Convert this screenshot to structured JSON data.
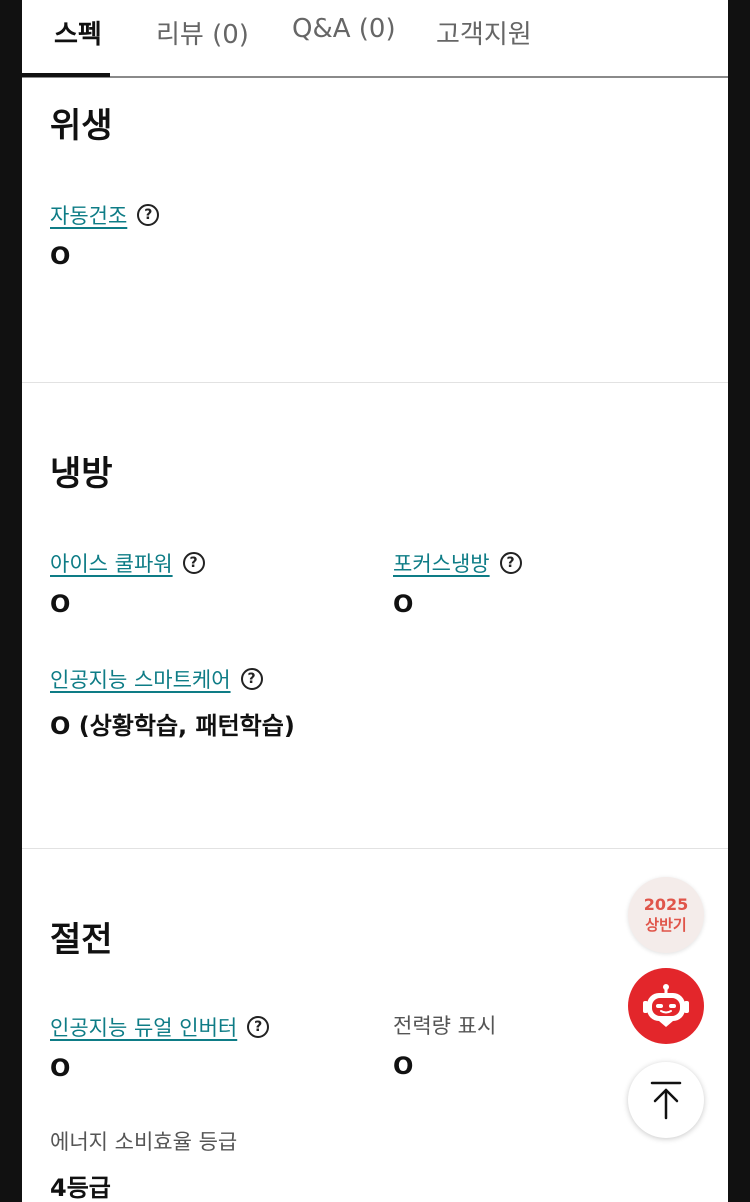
{
  "tabs": [
    {
      "label": "스펙",
      "active": true
    },
    {
      "label": "리뷰 (0)",
      "active": false
    },
    {
      "label": "Q&A (0)",
      "active": false
    },
    {
      "label": "고객지원",
      "active": false
    }
  ],
  "sections": {
    "hygiene": {
      "title": "위생",
      "items": [
        {
          "label": "자동건조",
          "value": "O",
          "has_help": true,
          "link": true
        }
      ]
    },
    "cooling": {
      "title": "냉방",
      "items": [
        {
          "label": "아이스 쿨파워",
          "value": "O",
          "has_help": true,
          "link": true
        },
        {
          "label": "포커스냉방",
          "value": "O",
          "has_help": true,
          "link": true
        },
        {
          "label": "인공지능 스마트케어",
          "value": "O (상황학습, 패턴학습)",
          "has_help": true,
          "link": true
        }
      ]
    },
    "power_saving": {
      "title": "절전",
      "items": [
        {
          "label": "인공지능 듀얼 인버터",
          "value": "O",
          "has_help": true,
          "link": true
        },
        {
          "label": "전력량 표시",
          "value": "O",
          "has_help": false,
          "link": false
        },
        {
          "label": "에너지 소비효율 등급",
          "value": "4등급",
          "has_help": false,
          "link": false
        }
      ]
    }
  },
  "help_icon_glyph": "?",
  "floating": {
    "badge_year": "2025",
    "badge_text": "상반기",
    "chatbot_icon": "chatbot-robot-icon",
    "top_icon": "arrow-up-to-top-icon"
  },
  "colors": {
    "link": "#0e7c86",
    "chatbot_bg": "#e3262b",
    "badge_text": "#e0554a"
  }
}
